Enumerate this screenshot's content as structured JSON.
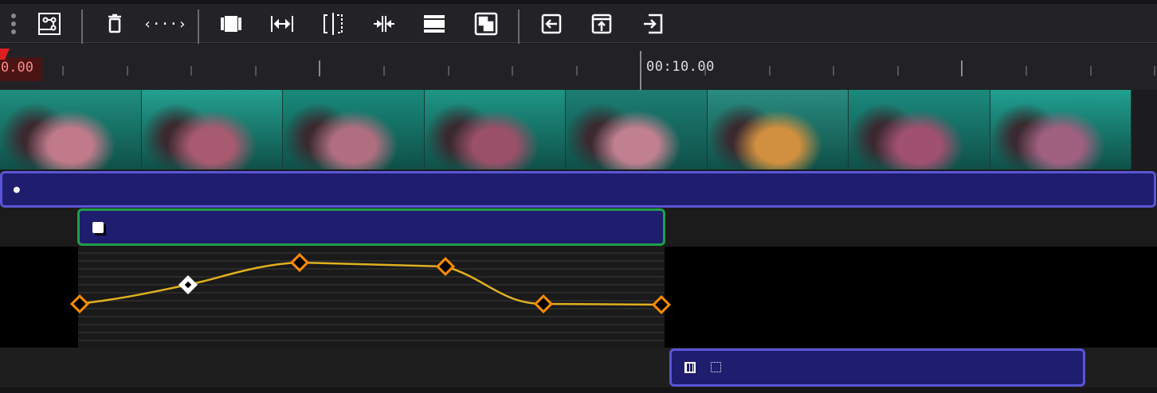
{
  "toolbar": {
    "icons": [
      "drag-handle-icon",
      "keyframe-graph-icon",
      "delete-icon",
      "expand-icon",
      "clip-icon",
      "fit-width-icon",
      "split-icon",
      "compress-icon",
      "align-icon",
      "picture-in-picture-icon",
      "import-left-icon",
      "export-up-icon",
      "export-right-icon"
    ]
  },
  "ruler": {
    "current_time": "0.00",
    "marker_label": "00:10.00"
  },
  "colors": {
    "accent": "#5a55d6",
    "clip_fill": "#1f1d6e",
    "selected_border": "#1fa04a",
    "curve": "#e0b020",
    "keyframe": "#ff8c00"
  }
}
